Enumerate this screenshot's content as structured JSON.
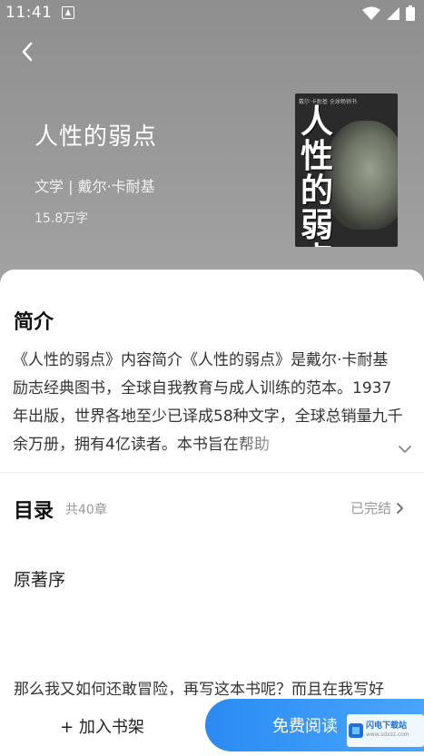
{
  "status_bar": {
    "time": "11:41"
  },
  "icons": {
    "app": "notification-a-icon",
    "wifi": "wifi-icon",
    "signal": "cell-signal-icon",
    "battery": "battery-icon",
    "back": "back-arrow-icon",
    "expand": "chevron-down-icon",
    "toc_arrow": "chevron-right-icon"
  },
  "book": {
    "title": "人性的弱点",
    "meta": "文学 | 戴尔·卡耐基",
    "words": "15.8万字",
    "cover_title": "人性的弱点",
    "cover_small_text": "戴尔·卡耐基 全球畅销书"
  },
  "intro": {
    "heading": "简介",
    "text": "《人性的弱点》内容简介《人性的弱点》是戴尔·卡耐基励志经典图书，全球自我教育与成人训练的范本。1937年出版，世界各地至少已译成58种文字，全球总销量九千余万册，拥有4亿读者。本书旨在帮助"
  },
  "toc": {
    "heading": "目录",
    "count": "共40章",
    "status": "已完结",
    "first_chapter": "原著序",
    "excerpt": "那么我又如何还敢冒险，再写这本书呢？而且在我写好"
  },
  "actions": {
    "add_shelf": "+ 加入书架",
    "read": "免费阅读"
  },
  "watermark": {
    "name": "闪电下载站",
    "url": "www.sdxzz.com"
  },
  "colors": {
    "accent": "#2a8bf2",
    "hero_bg": "#9a9a9a"
  }
}
